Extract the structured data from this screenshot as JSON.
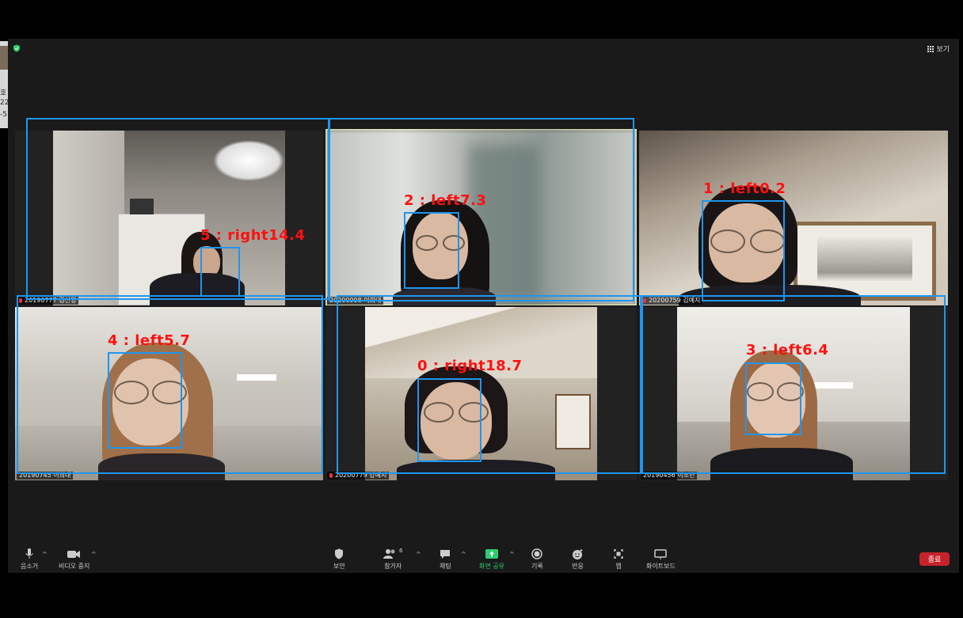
{
  "window": {
    "view_label": "보기",
    "end_label": "종료",
    "security_color": "#2ecc71"
  },
  "left_peek": {
    "lines": [
      "호",
      "22",
      "-5"
    ]
  },
  "participants": [
    {
      "name": "20190777 김선영",
      "muted": true,
      "active": false
    },
    {
      "name": "20200998 이희대",
      "muted": false,
      "active": true
    },
    {
      "name": "20200759 김예지",
      "muted": true,
      "active": false
    },
    {
      "name": "20190745 이희대",
      "muted": false,
      "active": false
    },
    {
      "name": "20200779 강예지",
      "muted": true,
      "active": false
    },
    {
      "name": "20190456 이조빈",
      "muted": false,
      "active": false
    }
  ],
  "detections": [
    {
      "label": "5 : right14.4"
    },
    {
      "label": "2 : left7.3"
    },
    {
      "label": "1 : left0.2"
    },
    {
      "label": "4 : left5.7"
    },
    {
      "label": "0 : right18.7"
    },
    {
      "label": "3 : left6.4"
    }
  ],
  "toolbar": {
    "mute": "음소거",
    "video": "비디오 중지",
    "security": "보안",
    "participants": "참가자",
    "participants_count": "6",
    "chat": "채팅",
    "share": "화면 공유",
    "record": "기록",
    "reactions": "반응",
    "apps": "앱",
    "whiteboard": "화이트보드"
  }
}
